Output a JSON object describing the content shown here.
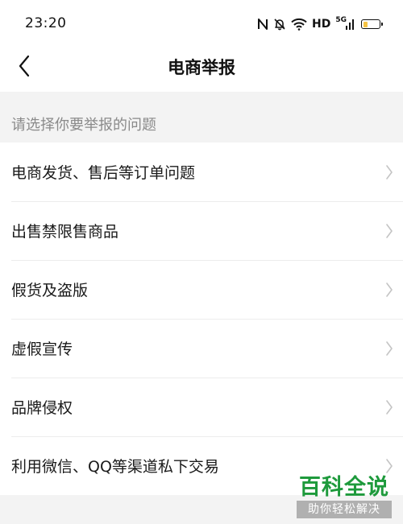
{
  "status_bar": {
    "time": "23:20",
    "hd_label": "HD",
    "network_label": "5G",
    "battery_level": 0.4,
    "icons": [
      "nfc-icon",
      "bell-muted-icon",
      "wifi-icon",
      "signal-icon",
      "battery-icon"
    ]
  },
  "nav": {
    "title": "电商举报",
    "back_icon": "chevron-left-icon"
  },
  "section": {
    "header": "请选择你要举报的问题"
  },
  "list": {
    "items": [
      {
        "label": "电商发货、售后等订单问题"
      },
      {
        "label": "出售禁限售商品"
      },
      {
        "label": "假货及盗版"
      },
      {
        "label": "虚假宣传"
      },
      {
        "label": "品牌侵权"
      },
      {
        "label": "利用微信、QQ等渠道私下交易"
      }
    ],
    "chevron_icon": "chevron-right-icon"
  },
  "watermark": {
    "main": "百科全说",
    "sub": "助你轻松解决"
  },
  "colors": {
    "background": "#f3f3f3",
    "surface": "#ffffff",
    "muted_text": "#8a8a8a",
    "watermark_green": "#1e9a3c",
    "battery_fill": "#f6c343"
  }
}
